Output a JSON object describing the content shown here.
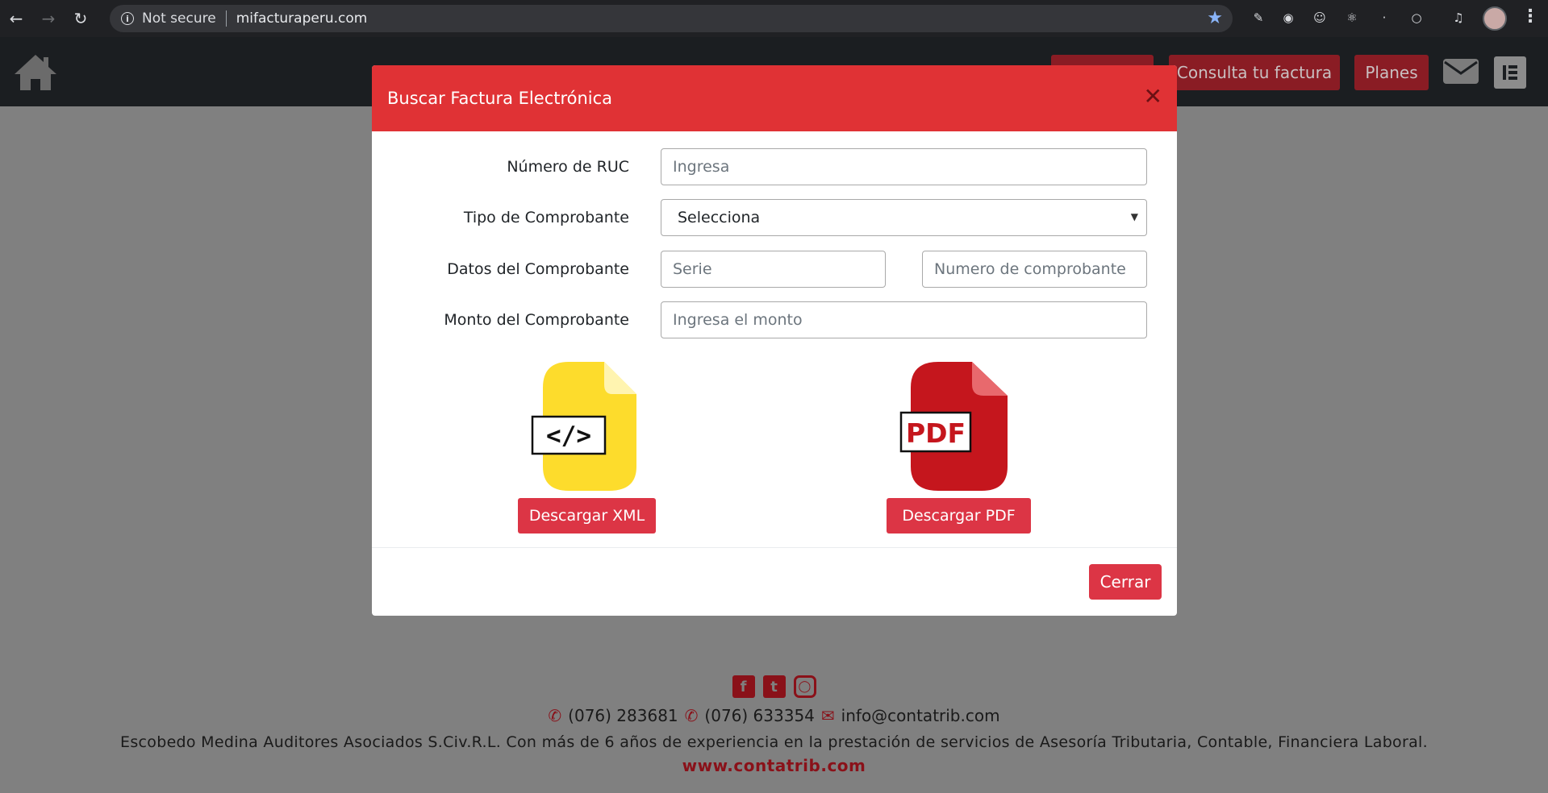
{
  "browser": {
    "security_label": "Not secure",
    "url": "mifacturaperu.com"
  },
  "header": {
    "nav_buttons": [
      "Consulta tu factura",
      "Planes"
    ]
  },
  "modal": {
    "title": "Buscar Factura Electrónica",
    "fields": {
      "ruc": {
        "label": "Número de RUC",
        "placeholder": "Ingresa"
      },
      "tipo": {
        "label": "Tipo de Comprobante",
        "selected": "Selecciona"
      },
      "datos": {
        "label": "Datos del Comprobante",
        "serie_placeholder": "Serie",
        "numero_placeholder": "Numero de comprobante"
      },
      "monto": {
        "label": "Monto del Comprobante",
        "placeholder": "Ingresa el monto"
      }
    },
    "xml_icon_text": "</>",
    "pdf_icon_text": "PDF",
    "download_xml_label": "Descargar XML",
    "download_pdf_label": "Descargar PDF",
    "close_label": "Cerrar"
  },
  "footer": {
    "phone1": "(076) 283681",
    "phone2": "(076) 633354",
    "email": "info@contatrib.com",
    "description": "Escobedo Medina Auditores Asociados S.Civ.R.L. Con más de 6 años de experiencia en la prestación de servicios de Asesoría Tributaria, Contable, Financiera Laboral.",
    "website": "www.contatrib.com"
  },
  "colors": {
    "modal_header": "#e03235",
    "button": "#dc3545",
    "overlay": "#808080"
  }
}
